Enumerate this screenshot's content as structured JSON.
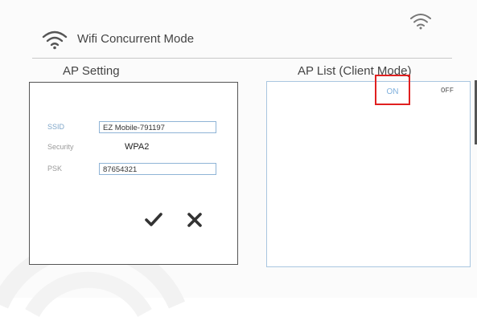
{
  "header": {
    "title": "Wifi Concurrent Mode",
    "title_icon": "wifi-icon",
    "corner_icon": "wifi-icon"
  },
  "ap_setting": {
    "label": "AP Setting",
    "ssid_label": "SSID",
    "ssid_value": "EZ Mobile-791197",
    "security_label": "Security",
    "security_value": "WPA2",
    "psk_label": "PSK",
    "psk_value": "87654321",
    "confirm_icon": "checkmark-icon",
    "cancel_icon": "close-icon"
  },
  "ap_list": {
    "label": "AP List (Client Mode)",
    "on_label": "ON",
    "off_label": "OFF"
  },
  "colors": {
    "highlight": "#e02020",
    "accent": "#7fb0dd",
    "input_border": "#8fb4d6"
  }
}
